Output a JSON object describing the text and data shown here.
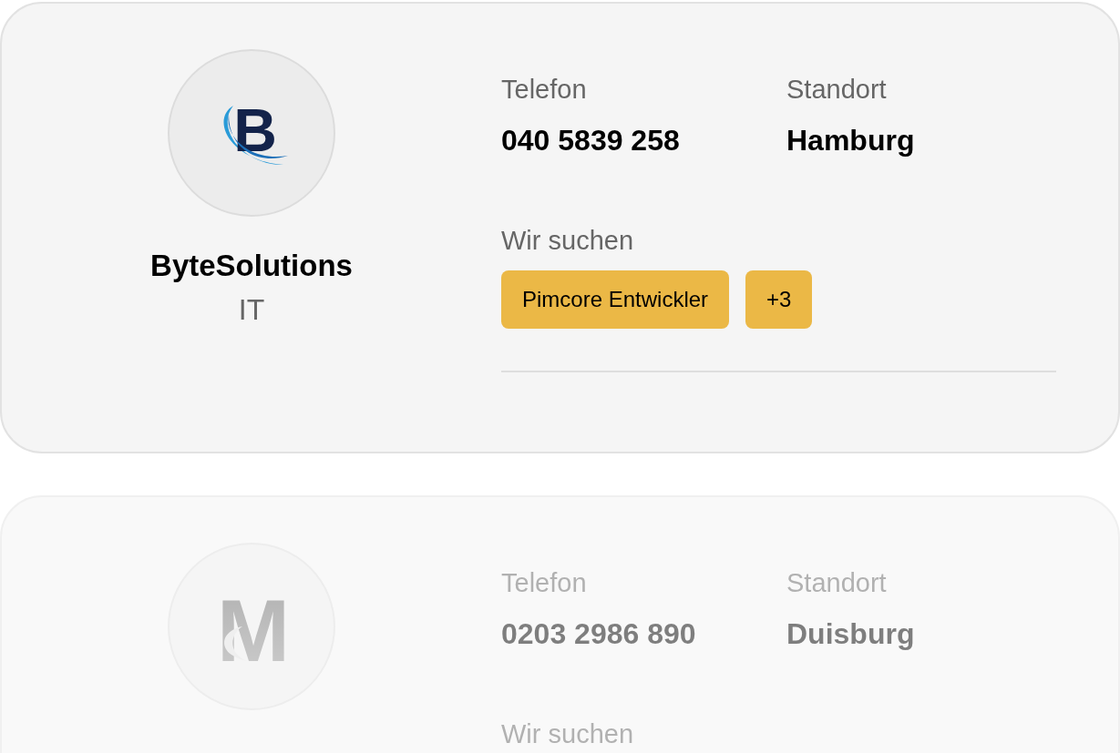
{
  "companies": [
    {
      "logo": {
        "kind": "swoosh",
        "letter": "B"
      },
      "name": "ByteSolutions",
      "industry": "IT",
      "faded": false,
      "fields": [
        {
          "label": "Telefon",
          "value": "040 5839 258"
        },
        {
          "label": "Standort",
          "value": "Hamburg"
        }
      ],
      "wanted_label": "Wir suchen",
      "tags": [
        "Pimcore Entwickler",
        "+3"
      ]
    },
    {
      "logo": {
        "kind": "road",
        "letter": "M"
      },
      "faded": true,
      "fields": [
        {
          "label": "Telefon",
          "value": "0203 2986 890"
        },
        {
          "label": "Standort",
          "value": "Duisburg"
        }
      ],
      "wanted_label": "Wir suchen"
    }
  ]
}
